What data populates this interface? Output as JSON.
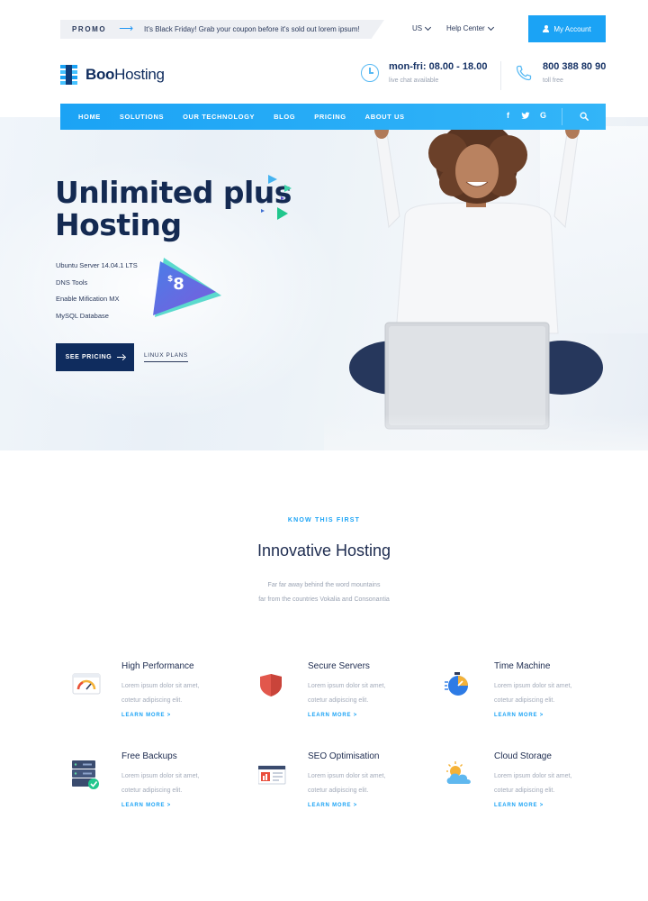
{
  "topbar": {
    "promo_tag": "PROMO",
    "promo_text": "It's Black Friday! Grab your coupon before it's sold out lorem ipsum!",
    "language": "US",
    "help": "Help Center",
    "account_button": "My Account"
  },
  "header": {
    "logo_part1": "Boo",
    "logo_part2": "Hosting",
    "hours_title": "mon-fri: 08.00 - 18.00",
    "hours_sub": "live chat available",
    "phone_title": "800 388 80 90",
    "phone_sub": "toll free"
  },
  "nav": {
    "items": [
      "HOME",
      "SOLUTIONS",
      "OUR TECHNOLOGY",
      "BLOG",
      "PRICING",
      "ABOUT US"
    ],
    "social": [
      "f",
      "t",
      "G"
    ]
  },
  "hero": {
    "title_line1": "Unlimited plus",
    "title_line2": "Hosting",
    "features": [
      "Ubuntu Server 14.04.1 LTS",
      "DNS Tools",
      "Enable Mification MX",
      "MySQL Database"
    ],
    "price_currency": "$",
    "price_value": "8",
    "primary_button": "SEE PRICING",
    "secondary_link": "LINUX PLANS"
  },
  "section": {
    "kicker": "KNOW THIS FIRST",
    "title": "Innovative Hosting",
    "desc_line1": "Far far away behind the word mountains",
    "desc_line2": "far from the countries Vokalia and Consonantia"
  },
  "features": [
    {
      "title": "High Performance",
      "line1": "Lorem ipsum dolor sit amet,",
      "line2": "cotetur adipiscing elit.",
      "link": "LEARN MORE >",
      "icon": "gauge-icon"
    },
    {
      "title": "Secure Servers",
      "line1": "Lorem ipsum dolor sit amet,",
      "line2": "cotetur adipiscing elit.",
      "link": "LEARN MORE >",
      "icon": "shield-icon"
    },
    {
      "title": "Time Machine",
      "line1": "Lorem ipsum dolor sit amet,",
      "line2": "cotetur adipiscing elit.",
      "link": "LEARN MORE >",
      "icon": "stopwatch-icon"
    },
    {
      "title": "Free Backups",
      "line1": "Lorem ipsum dolor sit amet,",
      "line2": "cotetur adipiscing elit.",
      "link": "LEARN MORE >",
      "icon": "server-stack-icon"
    },
    {
      "title": "SEO Optimisation",
      "line1": "Lorem ipsum dolor sit amet,",
      "line2": "cotetur adipiscing elit.",
      "link": "LEARN MORE >",
      "icon": "browser-chart-icon"
    },
    {
      "title": "Cloud Storage",
      "line1": "Lorem ipsum dolor sit amet,",
      "line2": "cotetur adipiscing elit.",
      "link": "LEARN MORE >",
      "icon": "cloud-sun-icon"
    }
  ],
  "colors": {
    "accent": "#1ba3f5",
    "navy": "#0f2c5e",
    "text_muted": "#9aa3b3"
  }
}
